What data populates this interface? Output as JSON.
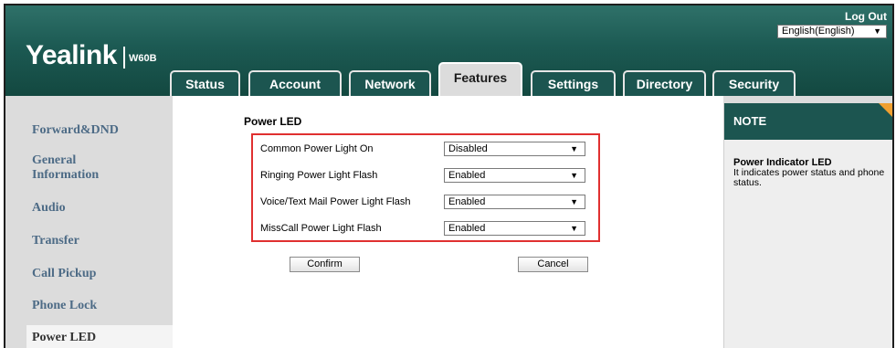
{
  "header": {
    "logo": "Yealink",
    "model": "W60B",
    "logout": "Log Out",
    "language": "English(English)"
  },
  "tabs": [
    {
      "label": "Status"
    },
    {
      "label": "Account"
    },
    {
      "label": "Network"
    },
    {
      "label": "Features",
      "active": true
    },
    {
      "label": "Settings"
    },
    {
      "label": "Directory"
    },
    {
      "label": "Security"
    }
  ],
  "sidebar": {
    "items": [
      {
        "label": "Forward&DND"
      },
      {
        "label": "General Information"
      },
      {
        "label": "Audio"
      },
      {
        "label": "Transfer"
      },
      {
        "label": "Call Pickup"
      },
      {
        "label": "Phone Lock"
      },
      {
        "label": "Power LED",
        "active": true
      }
    ]
  },
  "main": {
    "section_title": "Power LED",
    "rows": [
      {
        "label": "Common Power Light On",
        "value": "Disabled"
      },
      {
        "label": "Ringing Power Light Flash",
        "value": "Enabled"
      },
      {
        "label": "Voice/Text Mail Power Light Flash",
        "value": "Enabled"
      },
      {
        "label": "MissCall Power Light Flash",
        "value": "Enabled"
      }
    ],
    "confirm_label": "Confirm",
    "cancel_label": "Cancel"
  },
  "note": {
    "title": "NOTE",
    "heading": "Power Indicator LED",
    "text": "It indicates power status and phone status."
  },
  "colors": {
    "header_green": "#1c5a53",
    "tab_green": "#1c5550",
    "highlight_red": "#e03030",
    "note_corner": "#f0a030",
    "nav_link": "#4d6b86"
  }
}
